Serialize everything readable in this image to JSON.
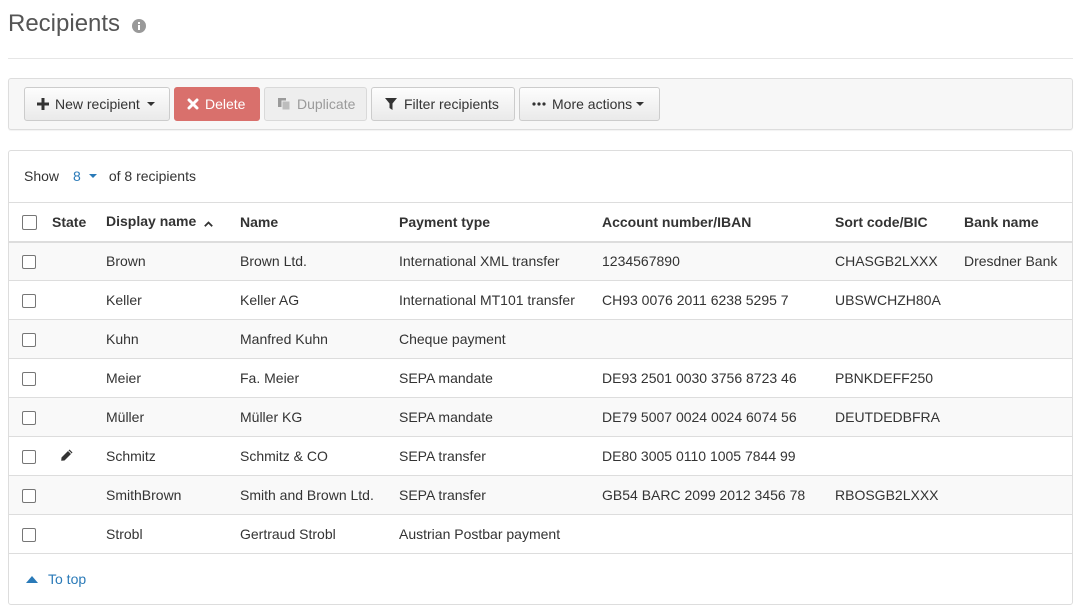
{
  "header": {
    "title": "Recipients",
    "info_icon": "info-circle-icon"
  },
  "toolbar": {
    "new_recipient": "New recipient",
    "delete": "Delete",
    "duplicate": "Duplicate",
    "filter": "Filter recipients",
    "more": "More actions"
  },
  "paging": {
    "show_label": "Show",
    "show_value": "8",
    "of_text": "of 8 recipients"
  },
  "table": {
    "columns": [
      "State",
      "Display name",
      "Name",
      "Payment type",
      "Account number/IBAN",
      "Sort code/BIC",
      "Bank name"
    ],
    "sorted_column": "Display name",
    "sort_direction": "ascending",
    "rows": [
      {
        "state": "",
        "display": "Brown",
        "name": "Brown Ltd.",
        "payment": "International XML transfer",
        "account": "1234567890",
        "sort": "CHASGB2LXXX",
        "bank": "Dresdner Bank"
      },
      {
        "state": "",
        "display": "Keller",
        "name": "Keller AG",
        "payment": "International MT101 transfer",
        "account": "CH93 0076 2011 6238 5295 7",
        "sort": "UBSWCHZH80A",
        "bank": ""
      },
      {
        "state": "",
        "display": "Kuhn",
        "name": "Manfred Kuhn",
        "payment": "Cheque payment",
        "account": "",
        "sort": "",
        "bank": ""
      },
      {
        "state": "",
        "display": "Meier",
        "name": "Fa. Meier",
        "payment": "SEPA mandate",
        "account": "DE93 2501 0030 3756 8723 46",
        "sort": "PBNKDEFF250",
        "bank": ""
      },
      {
        "state": "",
        "display": "Müller",
        "name": "Müller KG",
        "payment": "SEPA mandate",
        "account": "DE79 5007 0024 0024 6074 56",
        "sort": "DEUTDEDBFRA",
        "bank": ""
      },
      {
        "state": "pencil-icon",
        "display": "Schmitz",
        "name": "Schmitz & CO",
        "payment": "SEPA transfer",
        "account": "DE80 3005 0110 1005 7844 99",
        "sort": "",
        "bank": ""
      },
      {
        "state": "",
        "display": "SmithBrown",
        "name": "Smith and Brown Ltd.",
        "payment": "SEPA transfer",
        "account": "GB54 BARC 2099 2012 3456 78",
        "sort": "RBOSGB2LXXX",
        "bank": ""
      },
      {
        "state": "",
        "display": "Strobl",
        "name": "Gertraud Strobl",
        "payment": "Austrian Postbar payment",
        "account": "",
        "sort": "",
        "bank": ""
      }
    ]
  },
  "footer": {
    "to_top": "To top"
  },
  "colors": {
    "link": "#2a7ab8",
    "danger": "#d9706c",
    "border": "#dddddd"
  }
}
